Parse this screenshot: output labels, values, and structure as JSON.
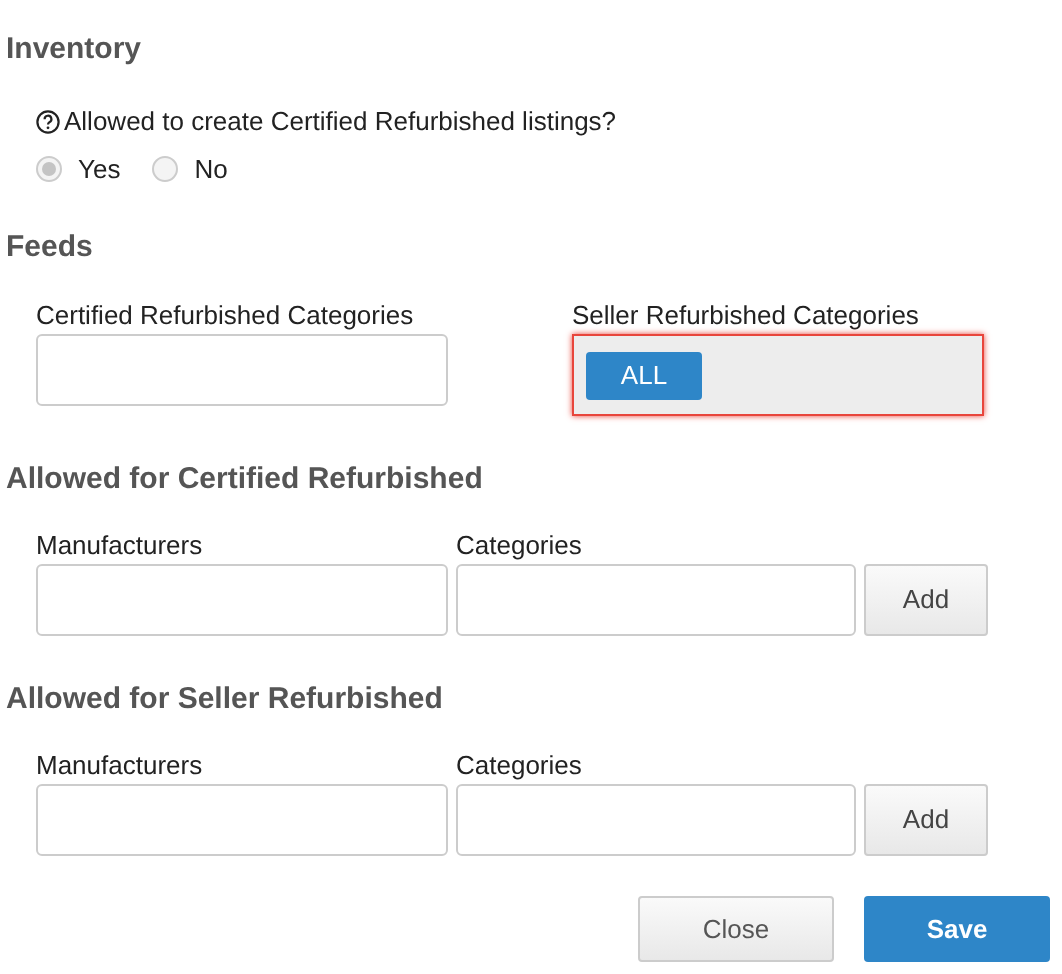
{
  "inventory": {
    "heading": "Inventory",
    "question": "Allowed to create Certified Refurbished listings?",
    "options": [
      {
        "label": "Yes",
        "selected": true
      },
      {
        "label": "No",
        "selected": false
      }
    ]
  },
  "feeds": {
    "heading": "Feeds",
    "fields": [
      {
        "label": "Certified Refurbished Categories",
        "invalid": false
      },
      {
        "label": "Seller Refurbished Categories",
        "invalid": true,
        "tokens": [
          "ALL"
        ]
      }
    ]
  },
  "sections": [
    {
      "heading": "Allowed for Certified Refurbished",
      "manufacturers_label": "Manufacturers",
      "categories_label": "Categories",
      "add": "Add"
    },
    {
      "heading": "Allowed for Seller Refurbished",
      "manufacturers_label": "Manufacturers",
      "categories_label": "Categories",
      "add": "Add"
    }
  ],
  "buttons": {
    "close": "Close",
    "save": "Save"
  }
}
